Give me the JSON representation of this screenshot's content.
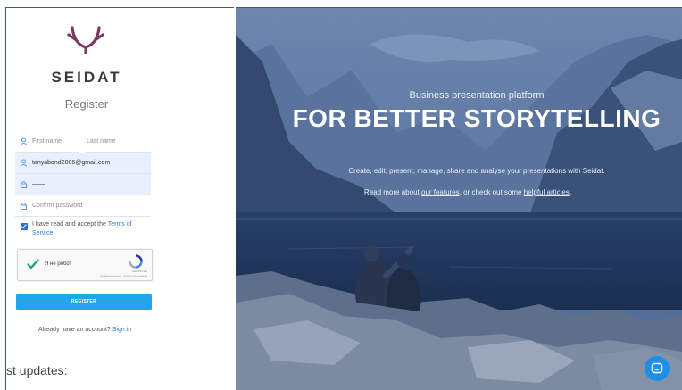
{
  "brand": {
    "name": "SEIDAT"
  },
  "form": {
    "title": "Register",
    "first_name_placeholder": "First name",
    "last_name_placeholder": "Last name",
    "email_value": "tanyabond2006@gmail.com",
    "password_value": "——",
    "confirm_password_placeholder": "Confirm password",
    "terms_prefix": "I have read and accept the ",
    "terms_link": "Terms of Service",
    "terms_suffix": ".",
    "register_button": "REGISTER",
    "have_account": "Already have an account?",
    "sign_in_link": "Sign in"
  },
  "captcha": {
    "label": "Я не робот",
    "brand": "reCAPTCHA",
    "terms": "Конфиденциальность - Условия использования"
  },
  "footer": {
    "updates": "st updates:"
  },
  "hero": {
    "subtitle": "Business presentation platform",
    "headline": "FOR BETTER STORYTELLING",
    "description": "Create, edit, present, manage, share and analyse your presentations with Seidat.",
    "read_more_prefix": "Read more about ",
    "features_link": "our features",
    "read_more_middle": ", or check out some ",
    "articles_link": "helpful articles",
    "read_more_suffix": "."
  },
  "colors": {
    "accent": "#22a5e6",
    "link": "#2e7ad1",
    "logo": "#7a3a5e",
    "overlay": "#2f4e7e"
  },
  "icons": [
    "antler-logo-icon",
    "user-icon",
    "lock-icon",
    "checkmark-icon",
    "recaptcha-icon",
    "chat-icon"
  ]
}
